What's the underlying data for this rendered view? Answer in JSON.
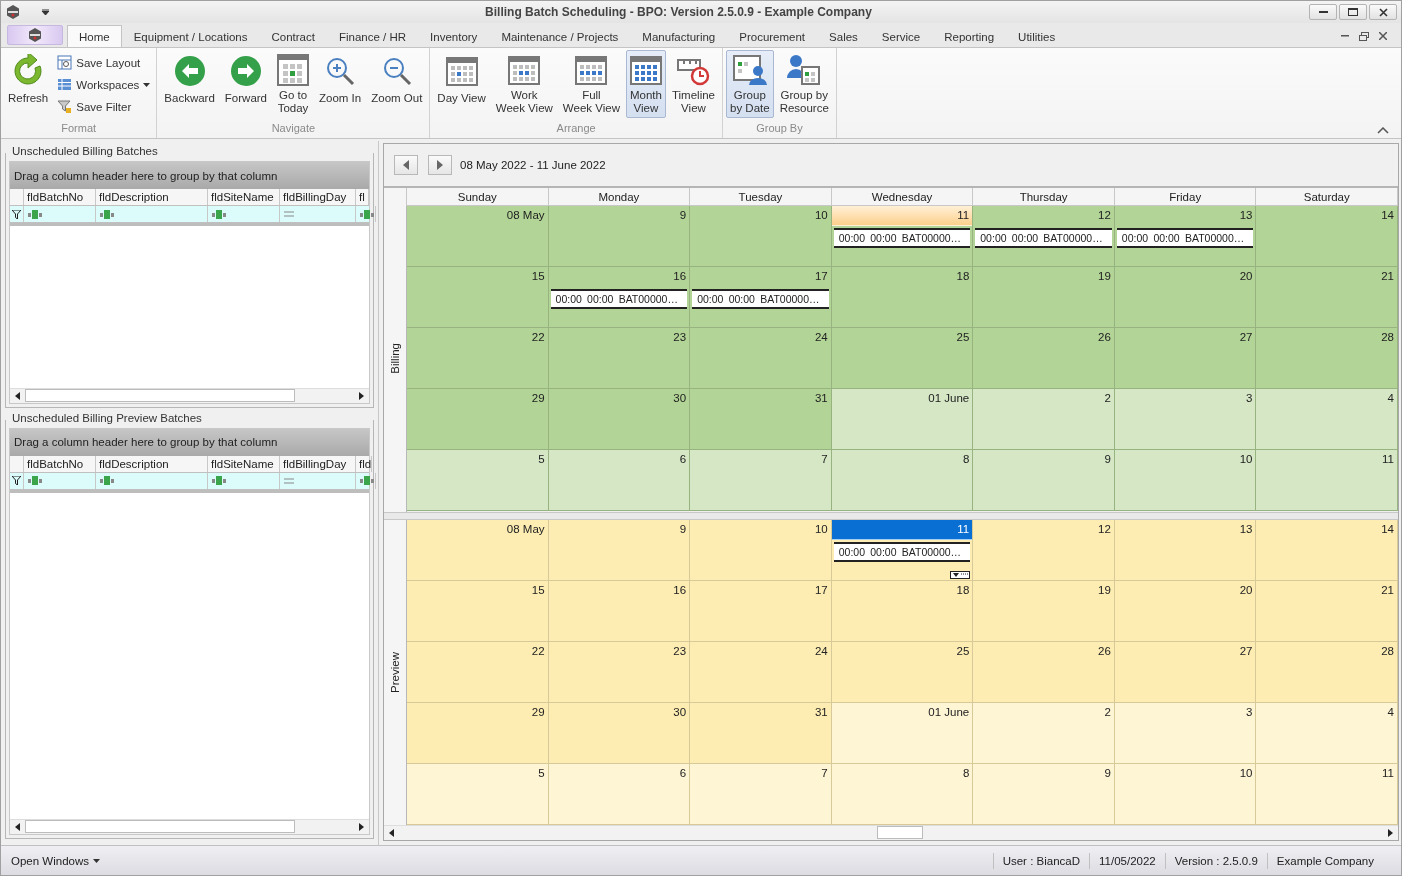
{
  "window": {
    "title": "Billing Batch Scheduling - BPO: Version 2.5.0.9 - Example Company"
  },
  "menu_tabs": [
    {
      "label": "Home",
      "selected": true
    },
    {
      "label": "Equipment / Locations",
      "selected": false
    },
    {
      "label": "Contract",
      "selected": false
    },
    {
      "label": "Finance / HR",
      "selected": false
    },
    {
      "label": "Inventory",
      "selected": false
    },
    {
      "label": "Maintenance / Projects",
      "selected": false
    },
    {
      "label": "Manufacturing",
      "selected": false
    },
    {
      "label": "Procurement",
      "selected": false
    },
    {
      "label": "Sales",
      "selected": false
    },
    {
      "label": "Service",
      "selected": false
    },
    {
      "label": "Reporting",
      "selected": false
    },
    {
      "label": "Utilities",
      "selected": false
    }
  ],
  "ribbon": {
    "groups": [
      {
        "label": "Format",
        "items": [
          {
            "label": "Refresh",
            "kind": "large",
            "selected": false,
            "dropdown": false
          },
          {
            "label": "Save Layout",
            "kind": "small",
            "selected": false,
            "dropdown": false
          },
          {
            "label": "Workspaces",
            "kind": "small",
            "selected": false,
            "dropdown": true
          },
          {
            "label": "Save Filter",
            "kind": "small",
            "selected": false,
            "dropdown": false
          }
        ]
      },
      {
        "label": "Navigate",
        "items": [
          {
            "label": "Backward",
            "kind": "large",
            "selected": false,
            "dropdown": false
          },
          {
            "label": "Forward",
            "kind": "large",
            "selected": false,
            "dropdown": false
          },
          {
            "label": "Go to\nToday",
            "kind": "large",
            "selected": false,
            "dropdown": false
          },
          {
            "label": "Zoom In",
            "kind": "large",
            "selected": false,
            "dropdown": false
          },
          {
            "label": "Zoom Out",
            "kind": "large",
            "selected": false,
            "dropdown": false
          }
        ]
      },
      {
        "label": "Arrange",
        "items": [
          {
            "label": "Day View",
            "kind": "large",
            "selected": false,
            "dropdown": false
          },
          {
            "label": "Work\nWeek View",
            "kind": "large",
            "selected": false,
            "dropdown": false
          },
          {
            "label": "Full\nWeek View",
            "kind": "large",
            "selected": false,
            "dropdown": false
          },
          {
            "label": "Month\nView",
            "kind": "large",
            "selected": true,
            "dropdown": false
          },
          {
            "label": "Timeline\nView",
            "kind": "large",
            "selected": false,
            "dropdown": false
          }
        ]
      },
      {
        "label": "Group By",
        "items": [
          {
            "label": "Group\nby Date",
            "kind": "large",
            "selected": true,
            "dropdown": false
          },
          {
            "label": "Group by\nResource",
            "kind": "large",
            "selected": false,
            "dropdown": false
          }
        ]
      }
    ]
  },
  "grids": [
    {
      "title": "Unscheduled Billing Batches",
      "group_hint": "Drag a column header here to group by that column",
      "columns": [
        {
          "label": "fldBatchNo",
          "kind": "text"
        },
        {
          "label": "fldDescription",
          "kind": "text"
        },
        {
          "label": "fldSiteName",
          "kind": "text"
        },
        {
          "label": "fldBillingDay",
          "kind": "equals"
        },
        {
          "label": "fl",
          "kind": "text"
        }
      ]
    },
    {
      "title": "Unscheduled Billing Preview Batches",
      "group_hint": "Drag a column header here to group by that column",
      "columns": [
        {
          "label": "fldBatchNo",
          "kind": "text"
        },
        {
          "label": "fldDescription",
          "kind": "text"
        },
        {
          "label": "fldSiteName",
          "kind": "text"
        },
        {
          "label": "fldBillingDay",
          "kind": "equals"
        },
        {
          "label": "fld",
          "kind": "text"
        }
      ]
    }
  ],
  "calendar": {
    "date_range": "08 May 2022 - 11 June 2022",
    "weekdays": [
      "Sunday",
      "Monday",
      "Tuesday",
      "Wednesday",
      "Thursday",
      "Friday",
      "Saturday"
    ],
    "groups": [
      {
        "label": "Billing",
        "color": "#b2d496",
        "weeks": [
          [
            {
              "day": "08 May",
              "other_month": false,
              "today": false,
              "selected": false,
              "more": false
            },
            {
              "day": "9",
              "other_month": false,
              "today": false,
              "selected": false,
              "more": false
            },
            {
              "day": "10",
              "other_month": false,
              "today": false,
              "selected": false,
              "more": false
            },
            {
              "day": "11",
              "other_month": false,
              "today": true,
              "selected": false,
              "more": false,
              "appointments": [
                {
                  "start": "00:00",
                  "end": "00:00",
                  "title": "BAT00000…"
                }
              ]
            },
            {
              "day": "12",
              "other_month": false,
              "today": false,
              "selected": false,
              "more": false,
              "appointments": [
                {
                  "start": "00:00",
                  "end": "00:00",
                  "title": "BAT00000…"
                }
              ]
            },
            {
              "day": "13",
              "other_month": false,
              "today": false,
              "selected": false,
              "more": false,
              "appointments": [
                {
                  "start": "00:00",
                  "end": "00:00",
                  "title": "BAT00000…"
                }
              ]
            },
            {
              "day": "14",
              "other_month": false,
              "today": false,
              "selected": false,
              "more": false
            }
          ],
          [
            {
              "day": "15",
              "other_month": false,
              "today": false,
              "selected": false,
              "more": false
            },
            {
              "day": "16",
              "other_month": false,
              "today": false,
              "selected": false,
              "more": false,
              "appointments": [
                {
                  "start": "00:00",
                  "end": "00:00",
                  "title": "BAT00000…"
                }
              ]
            },
            {
              "day": "17",
              "other_month": false,
              "today": false,
              "selected": false,
              "more": false,
              "appointments": [
                {
                  "start": "00:00",
                  "end": "00:00",
                  "title": "BAT00000…"
                }
              ]
            },
            {
              "day": "18",
              "other_month": false,
              "today": false,
              "selected": false,
              "more": false
            },
            {
              "day": "19",
              "other_month": false,
              "today": false,
              "selected": false,
              "more": false
            },
            {
              "day": "20",
              "other_month": false,
              "today": false,
              "selected": false,
              "more": false
            },
            {
              "day": "21",
              "other_month": false,
              "today": false,
              "selected": false,
              "more": false
            }
          ],
          [
            {
              "day": "22",
              "other_month": false,
              "today": false,
              "selected": false,
              "more": false
            },
            {
              "day": "23",
              "other_month": false,
              "today": false,
              "selected": false,
              "more": false
            },
            {
              "day": "24",
              "other_month": false,
              "today": false,
              "selected": false,
              "more": false
            },
            {
              "day": "25",
              "other_month": false,
              "today": false,
              "selected": false,
              "more": false
            },
            {
              "day": "26",
              "other_month": false,
              "today": false,
              "selected": false,
              "more": false
            },
            {
              "day": "27",
              "other_month": false,
              "today": false,
              "selected": false,
              "more": false
            },
            {
              "day": "28",
              "other_month": false,
              "today": false,
              "selected": false,
              "more": false
            }
          ],
          [
            {
              "day": "29",
              "other_month": false,
              "today": false,
              "selected": false,
              "more": false
            },
            {
              "day": "30",
              "other_month": false,
              "today": false,
              "selected": false,
              "more": false
            },
            {
              "day": "31",
              "other_month": false,
              "today": false,
              "selected": false,
              "more": false
            },
            {
              "day": "01 June",
              "other_month": true,
              "today": false,
              "selected": false,
              "more": false
            },
            {
              "day": "2",
              "other_month": true,
              "today": false,
              "selected": false,
              "more": false
            },
            {
              "day": "3",
              "other_month": true,
              "today": false,
              "selected": false,
              "more": false
            },
            {
              "day": "4",
              "other_month": true,
              "today": false,
              "selected": false,
              "more": false
            }
          ],
          [
            {
              "day": "5",
              "other_month": true,
              "today": false,
              "selected": false,
              "more": false
            },
            {
              "day": "6",
              "other_month": true,
              "today": false,
              "selected": false,
              "more": false
            },
            {
              "day": "7",
              "other_month": true,
              "today": false,
              "selected": false,
              "more": false
            },
            {
              "day": "8",
              "other_month": true,
              "today": false,
              "selected": false,
              "more": false
            },
            {
              "day": "9",
              "other_month": true,
              "today": false,
              "selected": false,
              "more": false
            },
            {
              "day": "10",
              "other_month": true,
              "today": false,
              "selected": false,
              "more": false
            },
            {
              "day": "11",
              "other_month": true,
              "today": false,
              "selected": false,
              "more": false
            }
          ]
        ]
      },
      {
        "label": "Preview",
        "color": "#fdedb3",
        "weeks": [
          [
            {
              "day": "08 May",
              "other_month": false,
              "today": false,
              "selected": false,
              "more": false
            },
            {
              "day": "9",
              "other_month": false,
              "today": false,
              "selected": false,
              "more": false
            },
            {
              "day": "10",
              "other_month": false,
              "today": false,
              "selected": false,
              "more": false
            },
            {
              "day": "11",
              "other_month": false,
              "today": true,
              "selected": true,
              "more": true,
              "appointments": [
                {
                  "start": "00:00",
                  "end": "00:00",
                  "title": "BAT00000…"
                }
              ]
            },
            {
              "day": "12",
              "other_month": false,
              "today": false,
              "selected": false,
              "more": false
            },
            {
              "day": "13",
              "other_month": false,
              "today": false,
              "selected": false,
              "more": false
            },
            {
              "day": "14",
              "other_month": false,
              "today": false,
              "selected": false,
              "more": false
            }
          ],
          [
            {
              "day": "15",
              "other_month": false,
              "today": false,
              "selected": false,
              "more": false
            },
            {
              "day": "16",
              "other_month": false,
              "today": false,
              "selected": false,
              "more": false
            },
            {
              "day": "17",
              "other_month": false,
              "today": false,
              "selected": false,
              "more": false
            },
            {
              "day": "18",
              "other_month": false,
              "today": false,
              "selected": false,
              "more": false
            },
            {
              "day": "19",
              "other_month": false,
              "today": false,
              "selected": false,
              "more": false
            },
            {
              "day": "20",
              "other_month": false,
              "today": false,
              "selected": false,
              "more": false
            },
            {
              "day": "21",
              "other_month": false,
              "today": false,
              "selected": false,
              "more": false
            }
          ],
          [
            {
              "day": "22",
              "other_month": false,
              "today": false,
              "selected": false,
              "more": false
            },
            {
              "day": "23",
              "other_month": false,
              "today": false,
              "selected": false,
              "more": false
            },
            {
              "day": "24",
              "other_month": false,
              "today": false,
              "selected": false,
              "more": false
            },
            {
              "day": "25",
              "other_month": false,
              "today": false,
              "selected": false,
              "more": false
            },
            {
              "day": "26",
              "other_month": false,
              "today": false,
              "selected": false,
              "more": false
            },
            {
              "day": "27",
              "other_month": false,
              "today": false,
              "selected": false,
              "more": false
            },
            {
              "day": "28",
              "other_month": false,
              "today": false,
              "selected": false,
              "more": false
            }
          ],
          [
            {
              "day": "29",
              "other_month": false,
              "today": false,
              "selected": false,
              "more": false
            },
            {
              "day": "30",
              "other_month": false,
              "today": false,
              "selected": false,
              "more": false
            },
            {
              "day": "31",
              "other_month": false,
              "today": false,
              "selected": false,
              "more": false
            },
            {
              "day": "01 June",
              "other_month": true,
              "today": false,
              "selected": false,
              "more": false
            },
            {
              "day": "2",
              "other_month": true,
              "today": false,
              "selected": false,
              "more": false
            },
            {
              "day": "3",
              "other_month": true,
              "today": false,
              "selected": false,
              "more": false
            },
            {
              "day": "4",
              "other_month": true,
              "today": false,
              "selected": false,
              "more": false
            }
          ],
          [
            {
              "day": "5",
              "other_month": true,
              "today": false,
              "selected": false,
              "more": false
            },
            {
              "day": "6",
              "other_month": true,
              "today": false,
              "selected": false,
              "more": false
            },
            {
              "day": "7",
              "other_month": true,
              "today": false,
              "selected": false,
              "more": false
            },
            {
              "day": "8",
              "other_month": true,
              "today": false,
              "selected": false,
              "more": false
            },
            {
              "day": "9",
              "other_month": true,
              "today": false,
              "selected": false,
              "more": false
            },
            {
              "day": "10",
              "other_month": true,
              "today": false,
              "selected": false,
              "more": false
            },
            {
              "day": "11",
              "other_month": true,
              "today": false,
              "selected": false,
              "more": false
            }
          ]
        ]
      }
    ]
  },
  "status_bar": {
    "open_windows": "Open Windows",
    "items": [
      "User : BiancaD",
      "11/05/2022",
      "Version : 2.5.0.9",
      "Example Company"
    ]
  }
}
